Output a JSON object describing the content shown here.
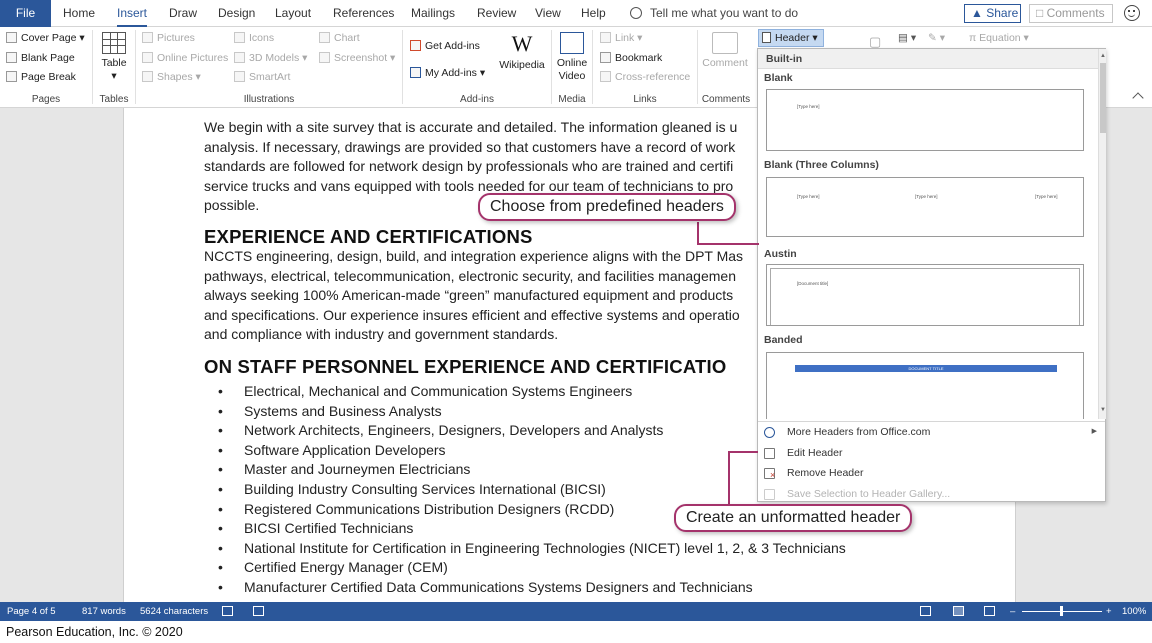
{
  "tabs": {
    "file": "File",
    "items": [
      "Home",
      "Insert",
      "Draw",
      "Design",
      "Layout",
      "References",
      "Mailings",
      "Review",
      "View",
      "Help"
    ],
    "tell_me": "Tell me what you want to do",
    "share": "Share",
    "comments": "Comments"
  },
  "ribbon": {
    "pages": {
      "cover_page": "Cover Page",
      "blank_page": "Blank Page",
      "page_break": "Page Break",
      "label": "Pages"
    },
    "tables": {
      "table": "Table",
      "label": "Tables"
    },
    "illustrations": {
      "pictures": "Pictures",
      "online_pictures": "Online Pictures",
      "shapes": "Shapes",
      "icons": "Icons",
      "models_3d": "3D Models",
      "smartart": "SmartArt",
      "chart": "Chart",
      "screenshot": "Screenshot",
      "label": "Illustrations"
    },
    "addins": {
      "get_addins": "Get Add-ins",
      "my_addins": "My Add-ins",
      "wikipedia": "Wikipedia",
      "label": "Add-ins"
    },
    "media": {
      "online_video_1": "Online",
      "online_video_2": "Video",
      "label": "Media"
    },
    "links": {
      "link": "Link",
      "bookmark": "Bookmark",
      "cross_reference": "Cross-reference",
      "label": "Links"
    },
    "comments": {
      "comment": "Comment",
      "label": "Comments"
    },
    "header_footer": {
      "header": "Header"
    },
    "symbols": {
      "equation": "Equation"
    }
  },
  "document": {
    "para1": [
      "We begin with a site survey that is accurate and detailed. The information gleaned is u",
      "analysis. If necessary, drawings are provided so that customers have a record of work",
      "standards are followed for network design by professionals who are trained and certifi",
      "service trucks and vans equipped with tools needed for our team of technicians to pro",
      "possible."
    ],
    "heading1": "EXPERIENCE AND CERTIFICATIONS",
    "para2": [
      "NCCTS engineering, design, build, and integration experience aligns with the DPT Mas",
      "pathways, electrical, telecommunication, electronic security, and facilities managemen",
      "always seeking 100% American-made “green” manufactured equipment and products",
      "and specifications. Our experience insures efficient and effective systems and operatio",
      "and compliance with industry and government standards."
    ],
    "heading2": "ON STAFF PERSONNEL EXPERIENCE AND CERTIFICATIO",
    "bullets": [
      "Electrical, Mechanical and Communication Systems Engineers",
      "Systems and Business Analysts",
      "Network Architects, Engineers, Designers, Developers and Analysts",
      "Software Application Developers",
      "Master and Journeymen Electricians",
      "Building Industry Consulting Services International (BICSI)",
      "Registered Communications Distribution Designers (RCDD)",
      "BICSI Certified Technicians",
      "National Institute for Certification in Engineering Technologies (NICET) level 1, 2, & 3 Technicians",
      "Certified Energy Manager (CEM)",
      "Manufacturer Certified Data Communications Systems Designers and Technicians"
    ]
  },
  "gallery": {
    "builtin": "Built-in",
    "sections": [
      "Blank",
      "Blank (Three Columns)",
      "Austin",
      "Banded"
    ],
    "placeholder": "[Type here]",
    "austin_placeholder": "[Document title]",
    "banded_placeholder": "DOCUMENT TITLE",
    "menu": {
      "more": "More Headers from Office.com",
      "edit": "Edit Header",
      "remove": "Remove Header",
      "save": "Save Selection to Header Gallery..."
    }
  },
  "callouts": {
    "predefined": "Choose from predefined headers",
    "unformatted": "Create an unformatted header"
  },
  "status": {
    "page": "Page 4 of 5",
    "words": "817 words",
    "characters": "5624 characters",
    "zoom": "100%",
    "zoom_level": 100
  },
  "credit": "Pearson Education, Inc. © 2020",
  "colors": {
    "accent": "#2b579a",
    "callout_border": "#a4336b",
    "header_button": "#c5d9f1",
    "banded_bar": "#3f70c4"
  },
  "icons": [
    "search-icon",
    "smiley-icon",
    "table-icon",
    "wikipedia-icon",
    "online-video-icon",
    "comment-icon",
    "header-icon",
    "globe-icon",
    "edit-header-icon",
    "remove-header-icon",
    "save-selection-icon"
  ]
}
